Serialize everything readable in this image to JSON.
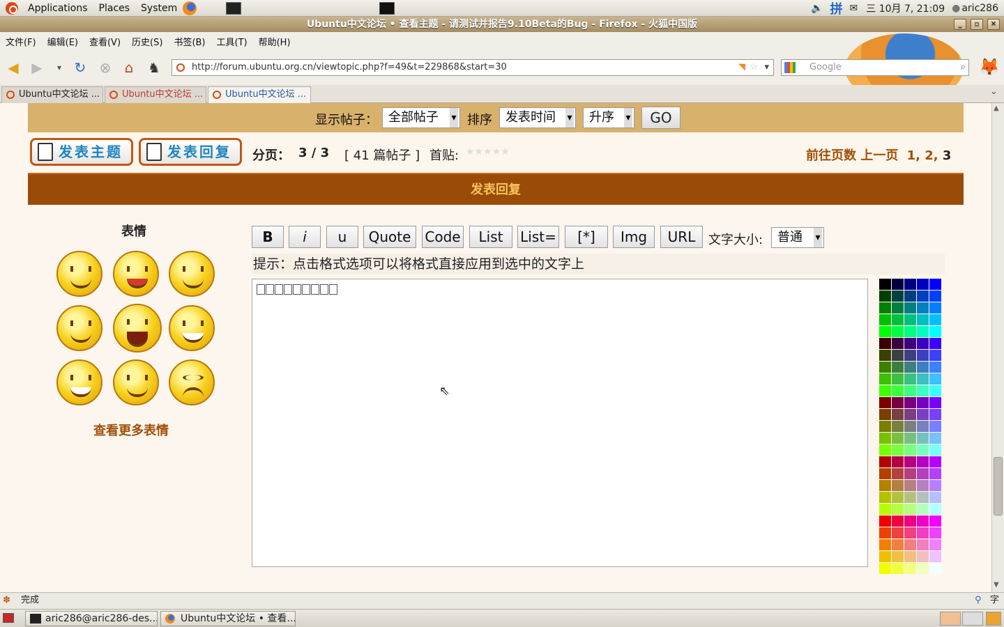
{
  "top_panel": {
    "menus": [
      "Applications",
      "Places",
      "System"
    ],
    "input_method": "拼",
    "datetime": "三 10月  7, 21:09",
    "user": "aric286"
  },
  "window": {
    "title": "Ubuntu中文论坛 • 查看主题 - 请测试并报告9.10Beta的Bug - Firefox - 火狐中国版"
  },
  "menubar": [
    "文件(F)",
    "编辑(E)",
    "查看(V)",
    "历史(S)",
    "书签(B)",
    "工具(T)",
    "帮助(H)"
  ],
  "url": "http://forum.ubuntu.org.cn/viewtopic.php?f=49&t=229868&start=30",
  "search": {
    "placeholder": "Google"
  },
  "tabs": [
    {
      "label": "Ubuntu中文论坛 ..."
    },
    {
      "label": "Ubuntu中文论坛 ..."
    },
    {
      "label": "Ubuntu中文论坛 ..."
    }
  ],
  "sort_bar": {
    "show_label": "显示帖子：",
    "show_value": "全部帖子",
    "sort_label": "排序",
    "sort_value": "发表时间",
    "order_value": "升序",
    "go_label": "GO"
  },
  "actions": {
    "new_topic": "发表主题",
    "post_reply": "发表回复"
  },
  "pagination": {
    "page_label": "分页：",
    "page_value": "3 / 3",
    "post_count": "[ 41 篇帖子 ]",
    "first_post_label": "首贴:",
    "goto_label": "前往页数",
    "prev_label": "上一页",
    "pages": [
      "1",
      "2",
      "3"
    ]
  },
  "reply": {
    "header": "发表回复",
    "smilies_title": "表情",
    "more_smilies": "查看更多表情",
    "format_buttons": [
      "B",
      "i",
      "u",
      "Quote",
      "Code",
      "List",
      "List=",
      "[*]",
      "Img",
      "URL"
    ],
    "font_size_label": "文字大小:",
    "font_size_value": "普通",
    "hint": "提示：点击格式选项可以将格式直接应用到选中的文字上"
  },
  "status": {
    "text": "完成"
  },
  "taskbar": [
    {
      "label": "aric286@aric286-des..."
    },
    {
      "label": "Ubuntu中文论坛 • 查看..."
    }
  ],
  "colors": {
    "sort_bar_bg": "#d8b16c",
    "reply_header_bg": "#9a4b07",
    "reply_header_text": "#f6c35c",
    "link_orange": "#a14f08",
    "button_blue": "#1f84c2"
  }
}
